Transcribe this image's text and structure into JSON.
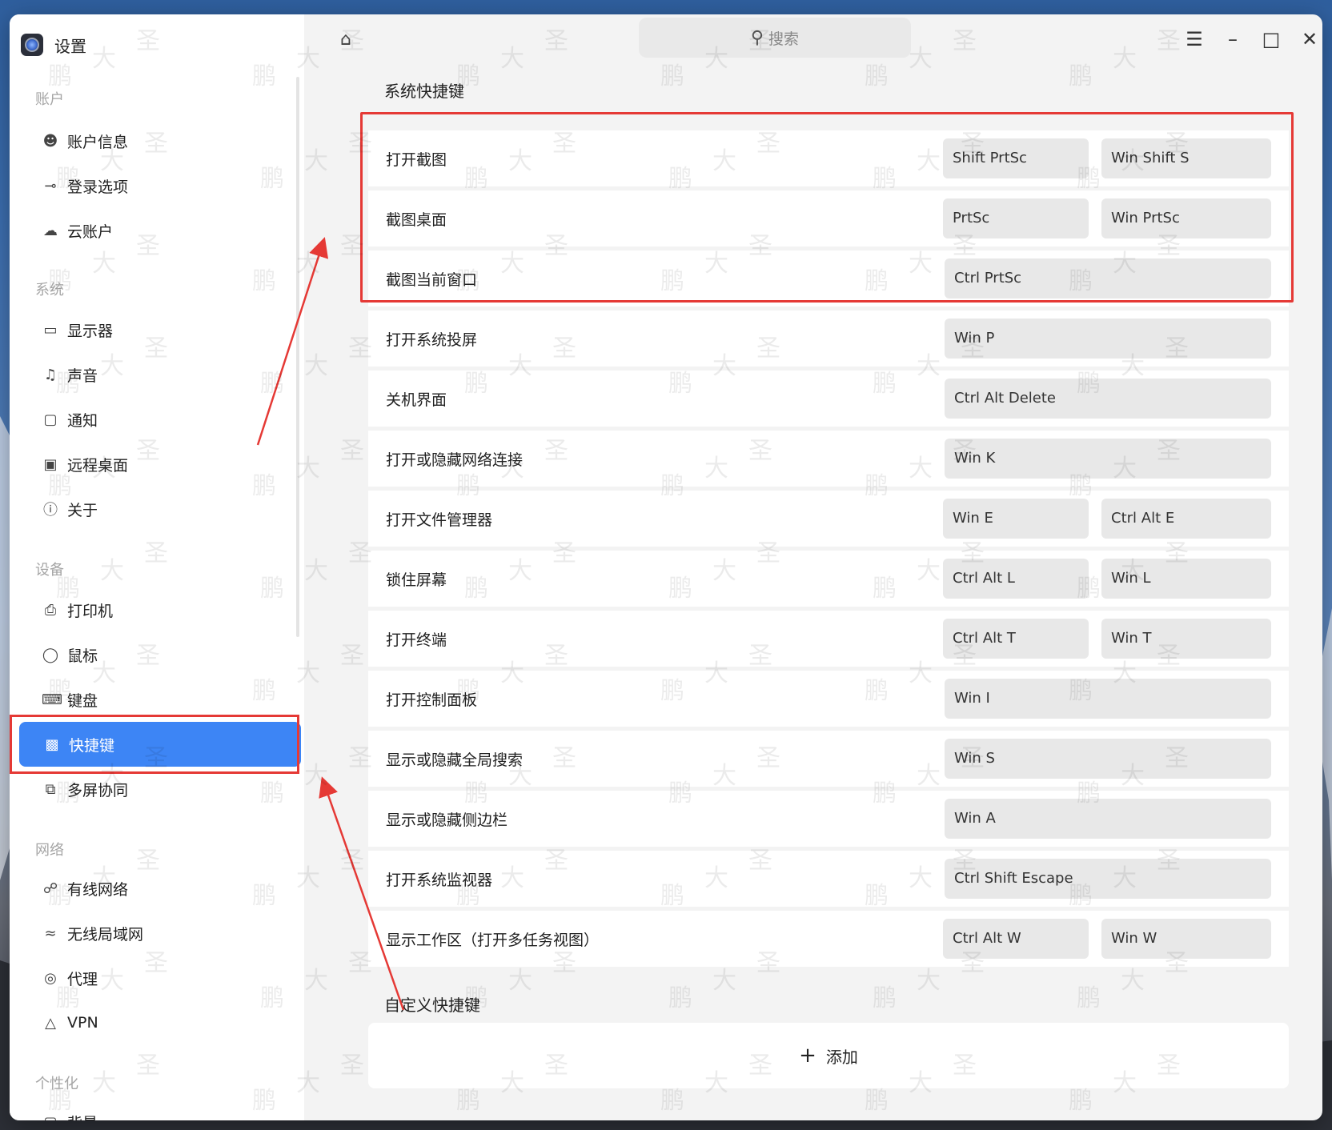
{
  "app": {
    "title": "设置"
  },
  "search": {
    "placeholder": "搜索"
  },
  "sidebar": {
    "sections": [
      {
        "label": "账户"
      },
      {
        "label": "系统"
      },
      {
        "label": "设备"
      },
      {
        "label": "网络"
      },
      {
        "label": "个性化"
      }
    ],
    "items": [
      {
        "label": "账户信息",
        "icon": "user-icon"
      },
      {
        "label": "登录选项",
        "icon": "key-icon"
      },
      {
        "label": "云账户",
        "icon": "cloud-icon"
      },
      {
        "label": "显示器",
        "icon": "monitor-icon"
      },
      {
        "label": "声音",
        "icon": "speaker-icon"
      },
      {
        "label": "通知",
        "icon": "notification-icon"
      },
      {
        "label": "远程桌面",
        "icon": "remote-desktop-icon"
      },
      {
        "label": "关于",
        "icon": "info-icon"
      },
      {
        "label": "打印机",
        "icon": "printer-icon"
      },
      {
        "label": "鼠标",
        "icon": "mouse-icon"
      },
      {
        "label": "键盘",
        "icon": "keyboard-icon"
      },
      {
        "label": "快捷键",
        "icon": "shortcut-icon",
        "active": true
      },
      {
        "label": "多屏协同",
        "icon": "multi-screen-icon"
      },
      {
        "label": "有线网络",
        "icon": "wired-network-icon"
      },
      {
        "label": "无线局域网",
        "icon": "wifi-icon"
      },
      {
        "label": "代理",
        "icon": "proxy-icon"
      },
      {
        "label": "VPN",
        "icon": "vpn-icon"
      },
      {
        "label": "背景",
        "icon": "background-icon"
      }
    ]
  },
  "main": {
    "system_title": "系统快捷键",
    "custom_title": "自定义快捷键",
    "add_label": "添加",
    "shortcuts": [
      {
        "name": "打开截图",
        "keys": [
          "Shift  PrtSc",
          "Win  Shift  S"
        ]
      },
      {
        "name": "截图桌面",
        "keys": [
          "PrtSc",
          "Win  PrtSc"
        ]
      },
      {
        "name": "截图当前窗口",
        "keys": [
          "Ctrl  PrtSc"
        ]
      },
      {
        "name": "打开系统投屏",
        "keys": [
          "Win  P"
        ]
      },
      {
        "name": "关机界面",
        "keys": [
          "Ctrl  Alt  Delete"
        ]
      },
      {
        "name": "打开或隐藏网络连接",
        "keys": [
          "Win  K"
        ]
      },
      {
        "name": "打开文件管理器",
        "keys": [
          "Win  E",
          "Ctrl  Alt  E"
        ]
      },
      {
        "name": "锁住屏幕",
        "keys": [
          "Ctrl  Alt  L",
          "Win  L"
        ]
      },
      {
        "name": "打开终端",
        "keys": [
          "Ctrl  Alt  T",
          "Win  T"
        ]
      },
      {
        "name": "打开控制面板",
        "keys": [
          "Win  I"
        ]
      },
      {
        "name": "显示或隐藏全局搜索",
        "keys": [
          "Win  S"
        ]
      },
      {
        "name": "显示或隐藏侧边栏",
        "keys": [
          "Win  A"
        ]
      },
      {
        "name": "打开系统监视器",
        "keys": [
          "Ctrl  Shift  Escape"
        ]
      },
      {
        "name": "显示工作区（打开多任务视图）",
        "keys": [
          "Ctrl  Alt  W",
          "Win  W"
        ]
      }
    ]
  },
  "watermark": {
    "chars": [
      "鹏",
      "大",
      "圣"
    ]
  }
}
